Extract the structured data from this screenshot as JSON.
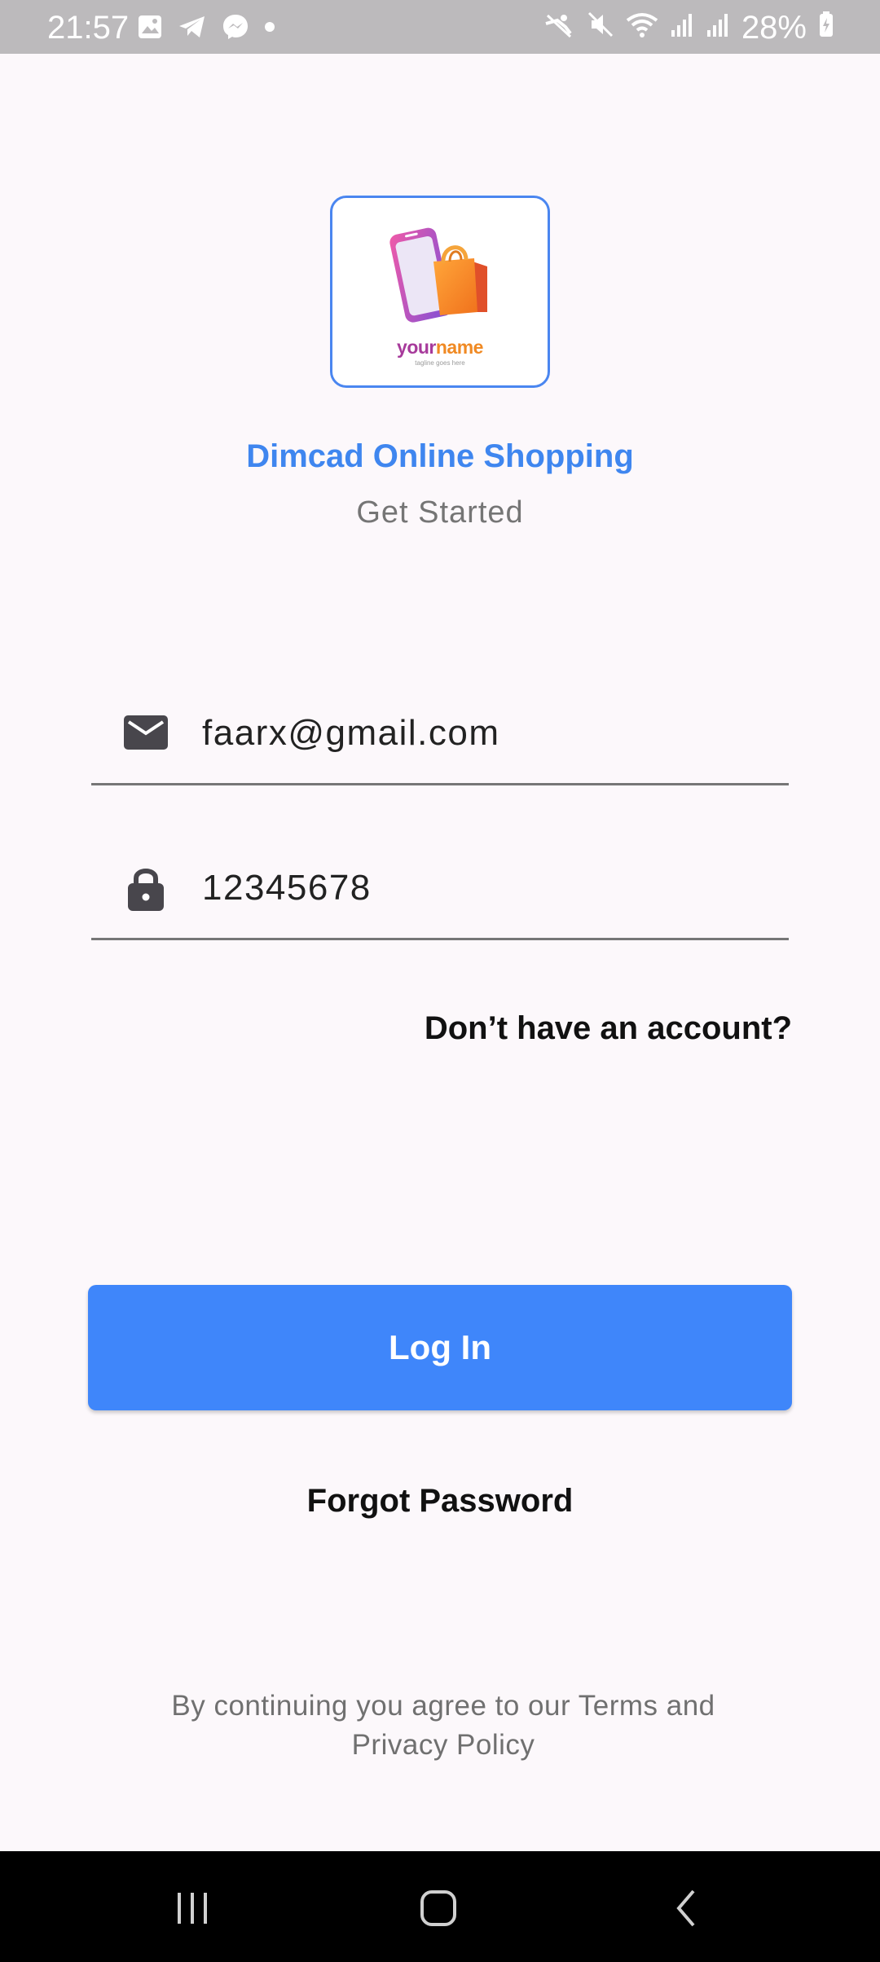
{
  "status_bar": {
    "time": "21:57",
    "battery": "28%",
    "left_icons": [
      "gallery-icon",
      "telegram-icon",
      "messenger-icon",
      "dot-icon"
    ],
    "right_icons": [
      "no-disturb-icon",
      "mute-icon",
      "wifi-icon",
      "signal-icon",
      "signal-icon",
      "battery-icon"
    ]
  },
  "logo": {
    "name_part1": "your",
    "name_part2": "name",
    "tagline": "tagline goes here"
  },
  "header": {
    "title": "Dimcad Online Shopping",
    "subtitle": "Get Started"
  },
  "form": {
    "email": {
      "icon": "mail-icon",
      "value": "faarx@gmail.com"
    },
    "password": {
      "icon": "lock-icon",
      "value": "12345678"
    }
  },
  "links": {
    "signup": "Don’t have an account?",
    "forgot": "Forgot Password"
  },
  "buttons": {
    "login": "Log In"
  },
  "footer": {
    "terms_line1": "By continuing you agree to our Terms and",
    "terms_line2": "Privacy Policy"
  },
  "nav": {
    "icons": [
      "recent-apps-icon",
      "home-icon",
      "back-icon"
    ]
  },
  "colors": {
    "accent": "#3f86fa",
    "title": "#3f86ef",
    "background": "#fcf8fb",
    "status_bar": "#bcbabc"
  }
}
